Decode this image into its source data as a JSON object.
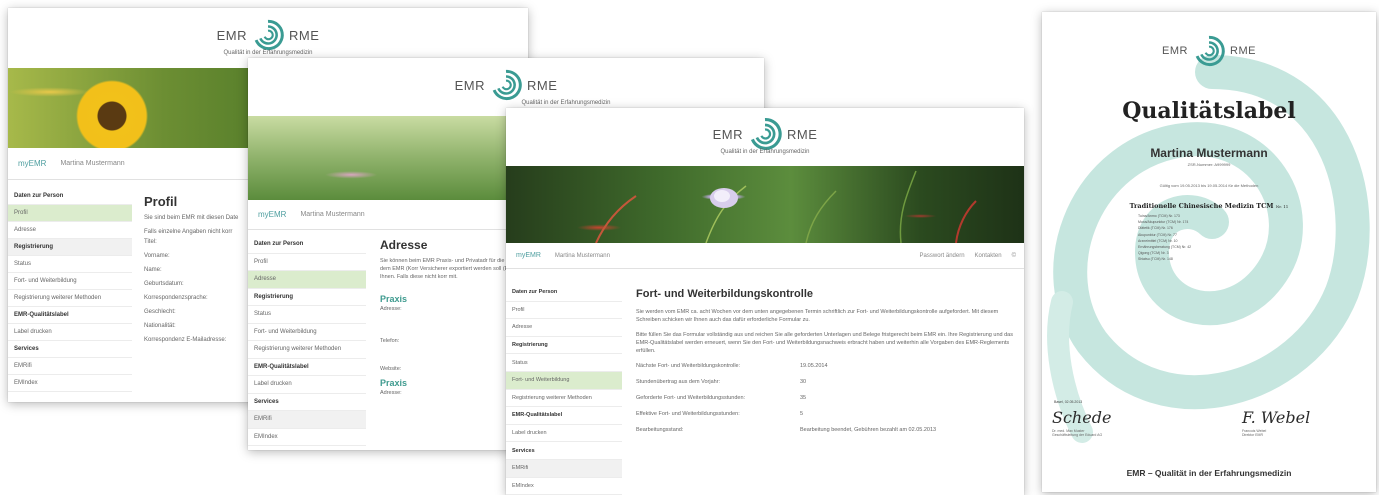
{
  "logo": {
    "left_word": "EMR",
    "right_word": "RME",
    "tagline": "Qualität in der Erfahrungsmedizin"
  },
  "colors": {
    "accent_teal": "#3a9b93",
    "selected_green": "#dbeccd",
    "swirl_light": "#c6e6df"
  },
  "nav_bar": {
    "brand": "myEMR",
    "user": "Martina Mustermann",
    "password_link": "Passwort ändern",
    "contact_link": "Kontakten",
    "extra": "©"
  },
  "screen1": {
    "sidebar": [
      {
        "label": "Daten zur Person",
        "style": "bold"
      },
      {
        "label": "Profil",
        "style": "sel"
      },
      {
        "label": "Adresse",
        "style": ""
      },
      {
        "label": "Registrierung",
        "style": "bold-gray"
      },
      {
        "label": "Status",
        "style": ""
      },
      {
        "label": "Fort- und Weiterbildung",
        "style": ""
      },
      {
        "label": "Registrierung weiterer Methoden",
        "style": ""
      },
      {
        "label": "EMR-Qualitätslabel",
        "style": "bold"
      },
      {
        "label": "Label drucken",
        "style": ""
      },
      {
        "label": "Services",
        "style": "bold"
      },
      {
        "label": "EMRifi",
        "style": ""
      },
      {
        "label": "EMIndex",
        "style": ""
      }
    ],
    "title": "Profil",
    "intro": "Sie sind beim EMR mit diesen Date",
    "intro2": "Falls einzelne Angaben nicht korr",
    "fields": [
      "Titel:",
      "Vorname:",
      "Name:",
      "Geburtsdatum:",
      "Korrespondenzsprache:",
      "Geschlecht:",
      "Nationalität:",
      "Korrespondenz E-Mailadresse:"
    ]
  },
  "screen2": {
    "sidebar": [
      {
        "label": "Daten zur Person",
        "style": "bold"
      },
      {
        "label": "Profil",
        "style": ""
      },
      {
        "label": "Adresse",
        "style": "sel"
      },
      {
        "label": "Registrierung",
        "style": "bold"
      },
      {
        "label": "Status",
        "style": ""
      },
      {
        "label": "Fort- und Weiterbildung",
        "style": ""
      },
      {
        "label": "Registrierung weiterer Methoden",
        "style": ""
      },
      {
        "label": "EMR-Qualitätslabel",
        "style": "bold"
      },
      {
        "label": "Label drucken",
        "style": ""
      },
      {
        "label": "Services",
        "style": "bold"
      },
      {
        "label": "EMRifi",
        "style": "gray"
      },
      {
        "label": "EMIndex",
        "style": ""
      }
    ],
    "title": "Adresse",
    "intro": "Sie können beim EMR Praxis- und Privatadr für die Korrespondenz mit dem EMR (Korr Versicherer exportiert werden soll (Expor Angaben von Ihnen. Falls diese nicht korr mit.",
    "praxis1": "Praxis",
    "praxis1_fields": [
      "Adresse:",
      "Telefon:",
      "Website:"
    ],
    "praxis2": "Praxis",
    "praxis2_fields": [
      "Adresse:"
    ]
  },
  "screen3": {
    "sidebar": [
      {
        "label": "Daten zur Person",
        "style": "bold"
      },
      {
        "label": "Profil",
        "style": ""
      },
      {
        "label": "Adresse",
        "style": ""
      },
      {
        "label": "Registrierung",
        "style": "bold"
      },
      {
        "label": "Status",
        "style": ""
      },
      {
        "label": "Fort- und Weiterbildung",
        "style": "sel"
      },
      {
        "label": "Registrierung weiterer Methoden",
        "style": ""
      },
      {
        "label": "EMR-Qualitätslabel",
        "style": "bold"
      },
      {
        "label": "Label drucken",
        "style": ""
      },
      {
        "label": "Services",
        "style": "bold"
      },
      {
        "label": "EMRifi",
        "style": "gray"
      },
      {
        "label": "EMIndex",
        "style": ""
      }
    ],
    "title": "Fort- und Weiterbildungskontrolle",
    "para1": "Sie werden vom EMR ca. acht Wochen vor dem unten angegebenen Termin schriftlich zur Fort- und Weiterbildungskontrolle aufgefordert. Mit diesem Schreiben schicken wir Ihnen auch das dafür erforderliche Formular zu.",
    "para2": "Bitte füllen Sie das Formular vollständig aus und reichen Sie alle geforderten Unterlagen und Belege fristgerecht beim EMR ein. Ihre Registrierung und das EMR-Qualitätslabel werden erneuert, wenn Sie den Fort- und Weiterbildungsnachweis erbracht haben und weiterhin alle Vorgaben des EMR-Reglements erfüllen.",
    "rows": [
      {
        "k": "Nächste Fort- und Weiterbildungskontrolle:",
        "v": "19.05.2014"
      },
      {
        "k": "Stundenübertrag aus dem Vorjahr:",
        "v": "30"
      },
      {
        "k": "Geforderte Fort- und Weiterbildungsstunden:",
        "v": "35"
      },
      {
        "k": "Effektive Fort- und Weiterbildungsstunden:",
        "v": "5"
      },
      {
        "k": "Bearbeitungsstand:",
        "v": "Bearbeitung beendet, Gebühren bezahlt am 02.05.2013"
      }
    ]
  },
  "certificate": {
    "title": "Qualitätslabel",
    "name": "Martina Mustermann",
    "sub": "ZSR-Nummer: A999999",
    "validity": "Gültig vom 19.05.2013 bis 19.05.2014 für die Methoden",
    "method": "Traditionelle Chinesische Medizin TCM",
    "method_suffix": "Nr. 11",
    "submethods": [
      "Tuina/Anmo (TCM) Nr. 173",
      "Moxa/Akupunktur (TCM) Nr. 174",
      "Diätetik (TCM) Nr. 176",
      "Akupunktur (TCM) Nr. 77",
      "Arzneimittel (TCM) Nr. 10",
      "Ernährungsberatung (TCM) Nr. 42",
      "Qigong (TCM) Nr. 3",
      "Shiatsu (TCM) Nr. 148"
    ],
    "place_date": "Basel, 02.05.2013",
    "sig_left": "Schede",
    "sig_left_name": "Dr. med. Max Muster",
    "sig_left_role": "Geschäftsleitung der Eduard AG",
    "sig_right": "F. Webel",
    "sig_right_name": "Francois Webel",
    "sig_right_role": "Direktor EMR",
    "footer": "EMR – Qualität in der Erfahrungsmedizin"
  }
}
